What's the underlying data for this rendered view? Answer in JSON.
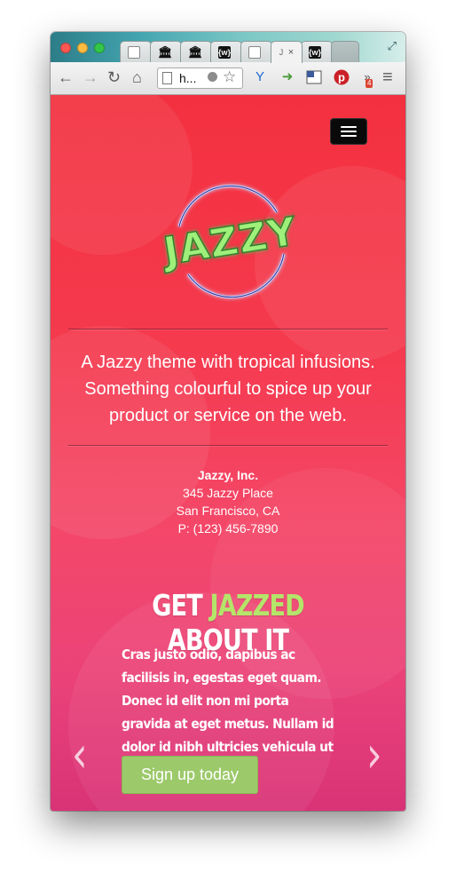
{
  "browser": {
    "tabs": [
      {
        "icon": "document-icon",
        "title": "",
        "letter": ""
      },
      {
        "icon": "bank-icon",
        "title": "",
        "letter": "/"
      },
      {
        "icon": "bank-icon",
        "title": "",
        "letter": "/"
      },
      {
        "icon": "w-icon",
        "title": "",
        "letter": "{w}"
      },
      {
        "icon": "document-icon",
        "title": "",
        "letter": ""
      },
      {
        "icon": "document-icon",
        "title": "J",
        "letter": "J",
        "active": true
      },
      {
        "icon": "w-icon",
        "title": "",
        "letter": "{w}"
      }
    ],
    "address_text": "h...",
    "back_glyph": "←",
    "forward_glyph": "→",
    "reload_glyph": "↻",
    "home_glyph": "⌂",
    "menu_glyph": "≡",
    "star_glyph": "☆",
    "close_tab_glyph": "×",
    "more_extensions_glyph": "»",
    "extension_badge": "4"
  },
  "page": {
    "logo_text": "JAZZY",
    "tagline": "A Jazzy theme with tropical infusions. Something colourful to spice up your product or service on the web.",
    "address": {
      "company": "Jazzy, Inc.",
      "street": "345 Jazzy Place",
      "city": "San Francisco, CA",
      "phone": "P: (123) 456-7890"
    },
    "headline": {
      "before": "GET ",
      "accent": "JAZZED",
      "after": " ABOUT IT"
    },
    "body": "Cras justo odio, dapibus ac facilisis in, egestas eget quam. Donec id elit non mi porta gravida at eget metus. Nullam id dolor id nibh ultricies vehicula ut id elit.",
    "cta_label": "Sign up today",
    "prev_glyph": "‹",
    "next_glyph": "›"
  },
  "colors": {
    "page_top": "#f3303f",
    "page_bottom": "#d93377",
    "accent_green": "#b4e56a",
    "button_green": "#9cc96a"
  }
}
